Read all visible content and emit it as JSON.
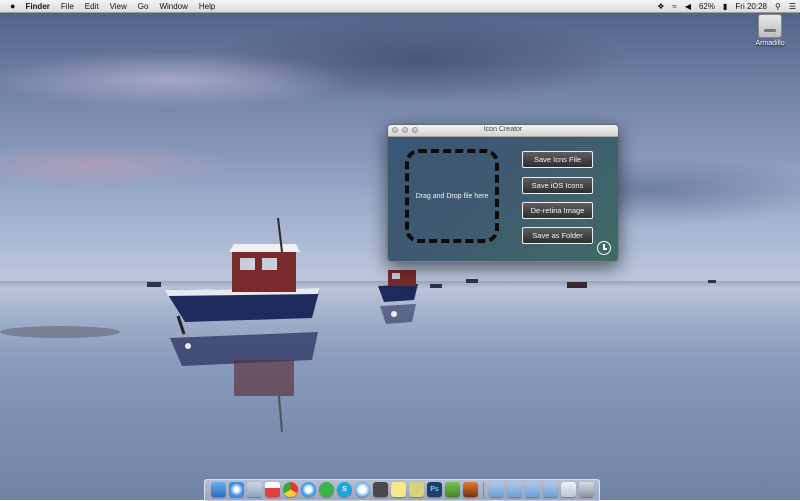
{
  "menubar": {
    "apple": "",
    "app_name": "Finder",
    "menus": [
      "File",
      "Edit",
      "View",
      "Go",
      "Window",
      "Help"
    ],
    "status": {
      "battery": "62%",
      "clock": "Fri 20:28"
    },
    "status_icons": [
      "dropbox-icon",
      "wifi-icon",
      "volume-icon",
      "battery-icon",
      "spotlight-icon",
      "list-icon"
    ]
  },
  "desktop": {
    "drive_label": "Armadillo"
  },
  "window": {
    "title": "Icon Creator",
    "dropzone_text": "Drag and Drop file here",
    "buttons": [
      "Save Icns File",
      "Save iOS Icons",
      "De-retina Image",
      "Save as Folder"
    ]
  },
  "dock": {
    "items": [
      "finder-icon",
      "safari-icon",
      "preview-icon",
      "calendar-icon",
      "chrome-icon",
      "itunes-icon",
      "spotify-icon",
      "skype-icon",
      "messages-icon",
      "stickies-icon",
      "notes-icon",
      "network-icon",
      "photoshop-icon",
      "app-icon",
      "folder-icon",
      "downloads-icon",
      "applications-icon",
      "documents-icon",
      "mail-icon",
      "trash-icon"
    ],
    "item_labels": {
      "photoshop": "Ps",
      "skype": "S"
    }
  }
}
